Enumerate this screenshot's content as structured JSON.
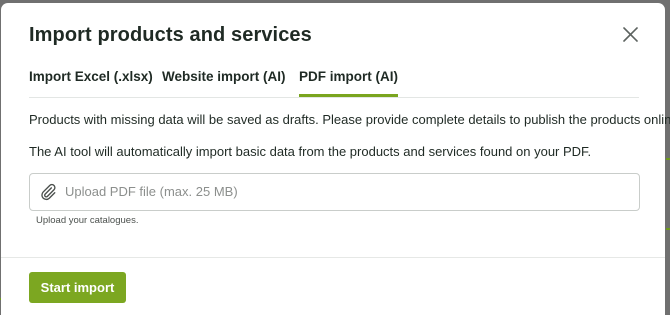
{
  "dialog": {
    "title": "Import products and services",
    "close_icon": "close-icon"
  },
  "tabs": [
    {
      "label": "Import Excel (.xlsx)",
      "active": false
    },
    {
      "label": "Website import (AI)",
      "active": false
    },
    {
      "label": "PDF import (AI)",
      "active": true
    }
  ],
  "content": {
    "info_drafts": "Products with missing data will be saved as drafts. Please provide complete details to publish the products online.",
    "info_ai": "The AI tool will automatically import basic data from the products and services found on your PDF.",
    "upload": {
      "icon": "paperclip-icon",
      "placeholder": "Upload PDF file (max. 25 MB)",
      "helper": "Upload your catalogues."
    }
  },
  "footer": {
    "start_label": "Start import"
  },
  "colors": {
    "accent": "#7ca721",
    "text": "#1f2a24",
    "backdrop": "#707070"
  }
}
